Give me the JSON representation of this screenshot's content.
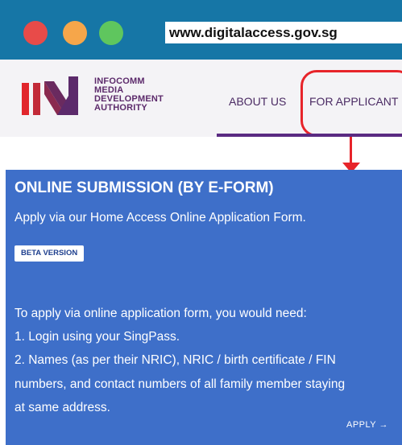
{
  "browser": {
    "url": "www.digitalaccess.gov.sg",
    "colors": {
      "chrome": "#1676a6",
      "close": "#e84b49",
      "minimize": "#f6a64a",
      "maximize": "#5fc65e"
    }
  },
  "header": {
    "logo_lines": [
      "INFOCOMM",
      "MEDIA",
      "DEVELOPMENT",
      "AUTHORITY"
    ],
    "nav": {
      "about": "ABOUT US",
      "applicant": "FOR APPLICANT"
    },
    "colors": {
      "brand": "#5c2a6b",
      "accent": "#e7242a"
    }
  },
  "submission": {
    "title": "ONLINE SUBMISSION (BY E-FORM)",
    "subtitle": "Apply via our Home Access Online Application Form.",
    "badge": "BETA VERSION",
    "intro": "To apply via online application form, you would need:",
    "step1": "1. Login using your SingPass.",
    "step2_line1": "2. Names (as per their NRIC), NRIC / birth certificate / FIN",
    "step2_line2": "numbers, and contact numbers of all family member staying",
    "step2_line3": "at same address.",
    "apply_label": "APPLY",
    "apply_icon": "arrow-right-icon",
    "colors": {
      "panel": "#3e6fc9"
    }
  }
}
